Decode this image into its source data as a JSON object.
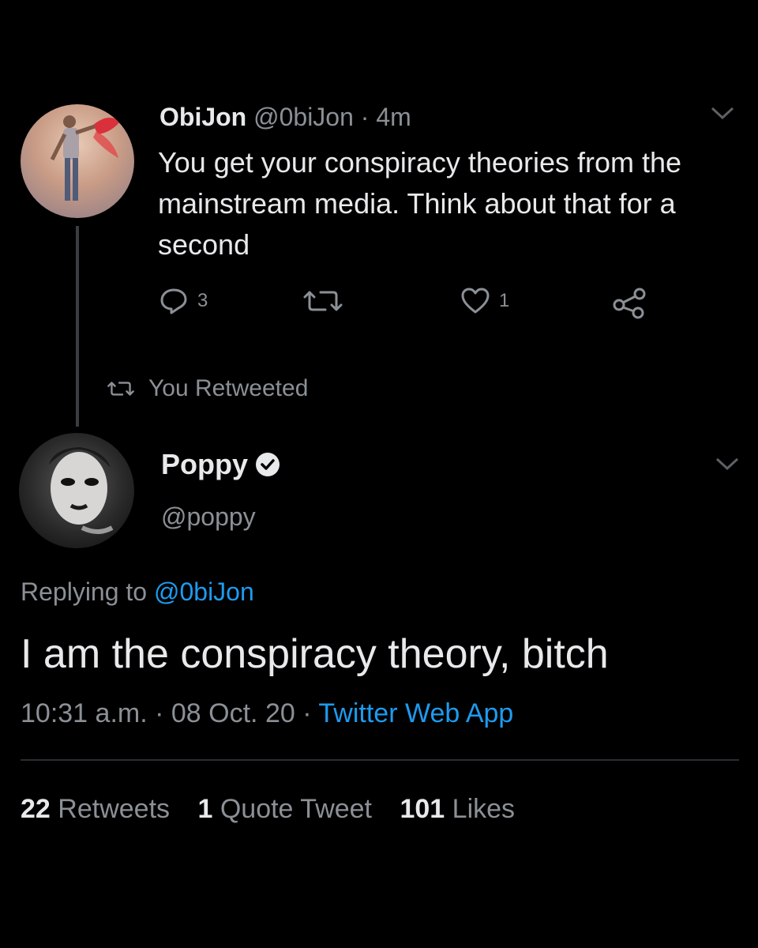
{
  "parent_tweet": {
    "display_name": "ObiJon",
    "handle": "@0biJon",
    "separator": "·",
    "time": "4m",
    "text": "You get your conspiracy theories from the mainstream media. Think about that for a second",
    "reply_count": "3",
    "like_count": "1"
  },
  "retweet_banner": "You Retweeted",
  "main_tweet": {
    "display_name": "Poppy",
    "handle": "@poppy",
    "replying_prefix": "Replying to",
    "replying_to": "@0biJon",
    "text": "I am the conspiracy theory, bitch",
    "time": "10:31 a.m.",
    "sep1": "·",
    "date": "08 Oct. 20",
    "sep2": "·",
    "source": "Twitter Web App"
  },
  "stats": {
    "retweets_count": "22",
    "retweets_label": "Retweets",
    "quotes_count": "1",
    "quotes_label": "Quote Tweet",
    "likes_count": "101",
    "likes_label": "Likes"
  },
  "colors": {
    "background": "#000000",
    "text": "#e7e9ea",
    "muted": "#8b9096",
    "link": "#1d9bf0"
  },
  "icons": [
    "reply-icon",
    "retweet-icon",
    "like-icon",
    "share-icon",
    "chevron-down-icon",
    "verified-badge-icon"
  ]
}
